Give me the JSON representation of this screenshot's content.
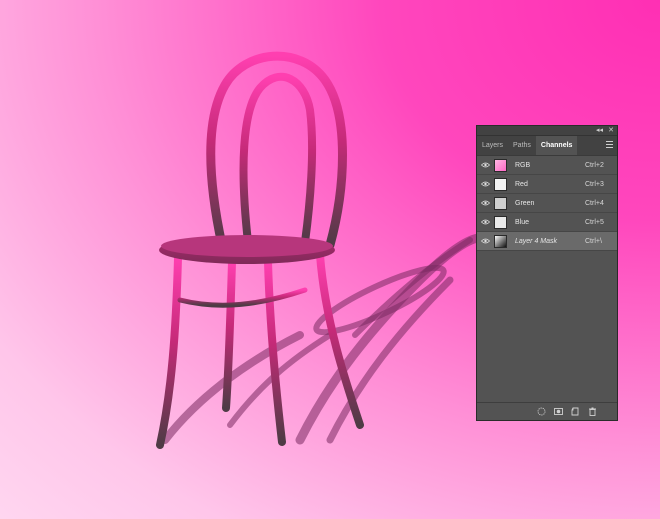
{
  "panel": {
    "tabs": [
      {
        "label": "Layers",
        "active": false
      },
      {
        "label": "Paths",
        "active": false
      },
      {
        "label": "Channels",
        "active": true
      }
    ],
    "collapse_glyph": "◂◂",
    "close_glyph": "✕",
    "channels": [
      {
        "name": "RGB",
        "shortcut": "Ctrl+2",
        "thumb_icon": "rgb-thumbnail-icon"
      },
      {
        "name": "Red",
        "shortcut": "Ctrl+3",
        "thumb_icon": "red-thumbnail-icon"
      },
      {
        "name": "Green",
        "shortcut": "Ctrl+4",
        "thumb_icon": "green-thumbnail-icon"
      },
      {
        "name": "Blue",
        "shortcut": "Ctrl+5",
        "thumb_icon": "blue-thumbnail-icon"
      },
      {
        "name": "Layer 4 Mask",
        "shortcut": "Ctrl+\\",
        "thumb_icon": "mask-thumbnail-icon"
      }
    ],
    "footer_icons": [
      "load-selection-icon",
      "save-selection-icon",
      "new-channel-icon",
      "trash-icon"
    ]
  },
  "colors": {
    "background_pink": "#ff2fb4",
    "chair": "#c2276f",
    "panel_bg": "#535353"
  }
}
